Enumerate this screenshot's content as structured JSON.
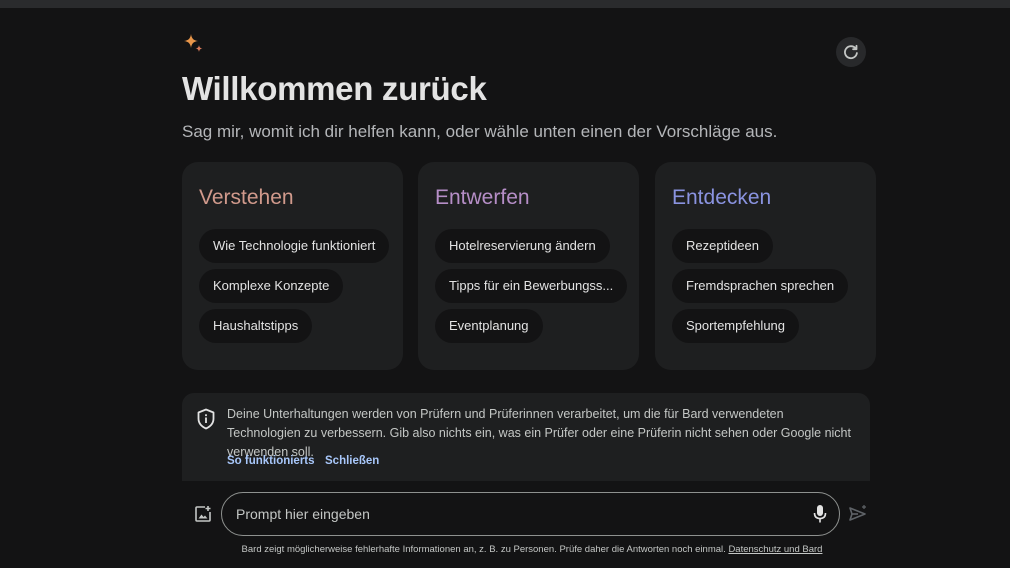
{
  "header": {
    "title": "Willkommen zurück",
    "subtitle": "Sag mir, womit ich dir helfen kann, oder wähle unten einen der Vorschläge aus.",
    "logo_icon": "sparkle-icon",
    "refresh_icon": "refresh-icon"
  },
  "cards": [
    {
      "title": "Verstehen",
      "color": "#d19a8c",
      "chips": [
        "Wie Technologie funktioniert",
        "Komplexe Konzepte",
        "Haushaltstipps"
      ]
    },
    {
      "title": "Entwerfen",
      "color": "#b68ec7",
      "chips": [
        "Hotelreservierung ändern",
        "Tipps für ein Bewerbungss...",
        "Eventplanung"
      ]
    },
    {
      "title": "Entdecken",
      "color": "#8a93e0",
      "chips": [
        "Rezeptideen",
        "Fremdsprachen sprechen",
        "Sportempfehlung"
      ]
    }
  ],
  "notice": {
    "text": "Deine Unterhaltungen werden von Prüfern und Prüferinnen verarbeitet, um die für Bard verwendeten Technologien zu verbessern. Gib also nichts ein, was ein Prüfer oder eine Prüferin nicht sehen oder Google nicht verwenden soll.",
    "link_how": "So funktionierts",
    "link_close": "Schließen",
    "icon": "shield-icon"
  },
  "prompt": {
    "placeholder": "Prompt hier eingeben",
    "value": ""
  },
  "footer": {
    "text": "Bard zeigt möglicherweise fehlerhafte Informationen an, z. B. zu Personen. Prüfe daher die Antworten noch einmal.",
    "link": "Datenschutz und Bard"
  }
}
